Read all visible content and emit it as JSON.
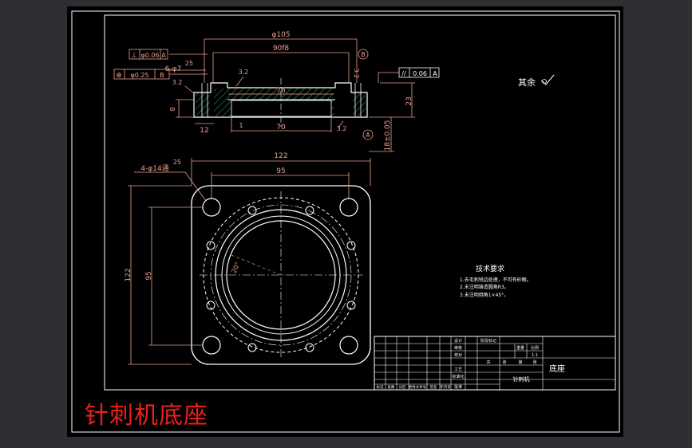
{
  "drawing": {
    "caption": "针刺机底座",
    "roughness_note": "其余",
    "section_view": {
      "dim_overall_dia": "φ105",
      "dim_fit": "90f8",
      "dim_inner": "76",
      "dim_bottom_inner": "70",
      "dim_height": "23",
      "dim_base_height": "18±0.05",
      "dim_flange": "8",
      "dim_step": "12",
      "dim_small": "1",
      "ra_1": "25",
      "ra_2": "3.2",
      "ra_3": "3.2",
      "ra_4": "3.2",
      "ra_5": "3.2",
      "hole_callout": "6-φ7",
      "perp_symbol": "⊥",
      "perp_tol": "φ0.06",
      "perp_datum": "A",
      "pos_symbol": "⊕",
      "pos_tol": "φ0.25",
      "pos_datum": "B",
      "par_symbol": "//",
      "par_tol": "0.06",
      "par_datum": "A",
      "datum_a": "A",
      "datum_b": "B"
    },
    "plan_view": {
      "dim_width": "122",
      "dim_inner_width": "95",
      "dim_height": "122",
      "dim_inner_height": "95",
      "corner_callout": "4-φ14通",
      "ra": "25",
      "angle": "20°"
    },
    "tech_requirements": {
      "title": "技术要求",
      "lines": [
        "1.去毛刺锐边处理，不可有砂眼。",
        "2.未注明铸造圆角R3。",
        "3.未注明倒角1×45°。"
      ]
    },
    "title_block": {
      "part_name": "底座",
      "machine_name": "针刺机",
      "scale": "1:1",
      "labels": [
        "设计",
        "审核",
        "校对",
        "工艺",
        "标准化",
        "批准"
      ],
      "bottom_labels": [
        "标记",
        "处数",
        "分区",
        "更改文件号",
        "签名",
        "年月日"
      ],
      "col_labels": [
        "阶段标记",
        "重量",
        "比例"
      ],
      "sheet_labels": [
        "共",
        "张",
        "第",
        "张"
      ]
    }
  },
  "colors": {
    "viewport_bg": "#2e2f33",
    "sheet_bg": "#000000",
    "line": "#ffffff",
    "dimension": "#e8a090",
    "hatch": "#2bb673",
    "caption": "#e8201c"
  }
}
